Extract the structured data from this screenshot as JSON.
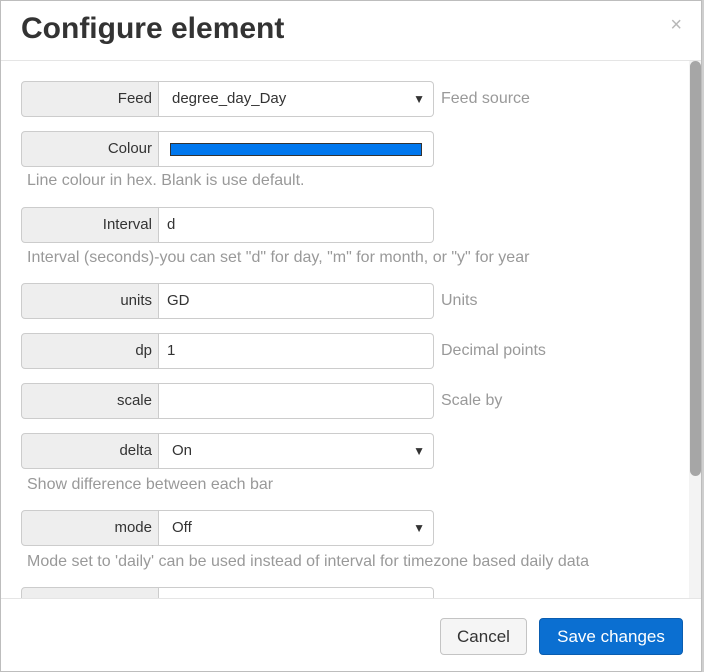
{
  "dialog": {
    "title": "Configure element",
    "close_glyph": "×"
  },
  "fields": {
    "feed": {
      "label": "Feed",
      "value": "degree_day_Day",
      "hint": "Feed source"
    },
    "colour": {
      "label": "Colour",
      "value_color": "#0077ee",
      "hint": "Line colour in hex. Blank is use default."
    },
    "interval": {
      "label": "Interval",
      "value": "d",
      "hint": "Interval (seconds)-you can set \"d\" for day, \"m\" for month, or \"y\" for year"
    },
    "units": {
      "label": "units",
      "value": "GD",
      "hint": "Units"
    },
    "dp": {
      "label": "dp",
      "value": "1",
      "hint": "Decimal points"
    },
    "scale": {
      "label": "scale",
      "value": "",
      "hint": "Scale by"
    },
    "delta": {
      "label": "delta",
      "value": "On",
      "hint": "Show difference between each bar"
    },
    "mode": {
      "label": "mode",
      "value": "Off",
      "hint": "Mode set to 'daily' can be used instead of interval for timezone based daily data"
    }
  },
  "footer": {
    "cancel_label": "Cancel",
    "save_label": "Save changes"
  },
  "icons": {
    "dropdown": "chevron-down-icon",
    "close": "close-icon"
  }
}
